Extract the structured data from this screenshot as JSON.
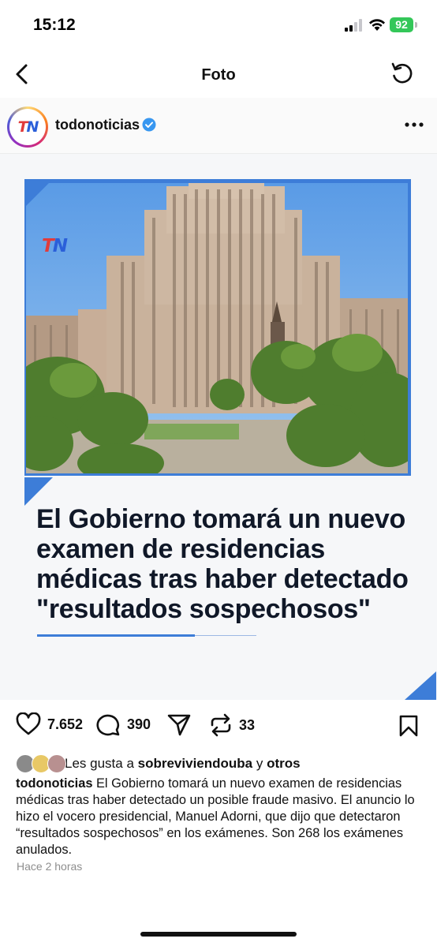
{
  "status_bar": {
    "time": "15:12",
    "battery": "92"
  },
  "nav": {
    "title": "Foto"
  },
  "account": {
    "username": "todonoticias",
    "verified": true,
    "avatar_logo": "TN"
  },
  "post": {
    "image_logo": "TN",
    "headline": "El Gobierno tomará un nuevo examen de residencias médicas tras haber detectado \"resultados sospechosos\"",
    "accent_color": "#3d7dd8"
  },
  "actions": {
    "likes_count": "7.652",
    "comments_count": "390",
    "reposts_count": "33",
    "icons": [
      "heart-icon",
      "comment-icon",
      "share-icon",
      "repost-icon",
      "bookmark-icon"
    ]
  },
  "likes": {
    "prefix": "Les gusta a",
    "user": "sobreviviendouba",
    "connector": "y",
    "others": "otros"
  },
  "caption": {
    "username": "todonoticias",
    "text": "El Gobierno tomará un nuevo examen de residencias médicas tras haber detectado un posible fraude masivo. El anuncio lo hizo el vocero presidencial, Manuel Adorni, que dijo que detectaron “resultados sospechosos” en los exámenes. Son 268 los exámenes anulados."
  },
  "time_ago": "Hace 2 horas"
}
